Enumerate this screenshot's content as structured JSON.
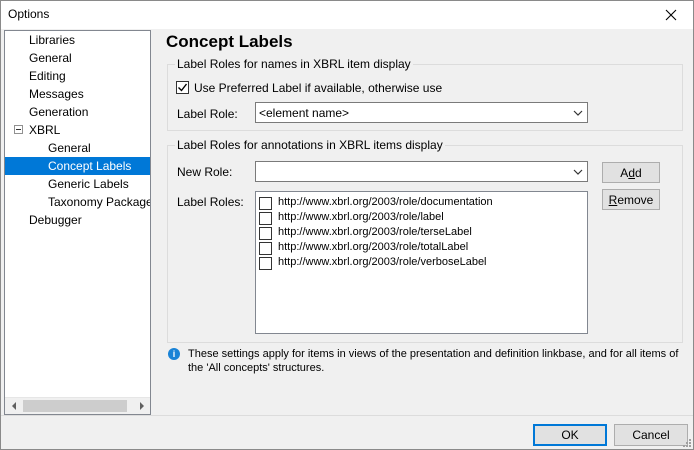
{
  "window": {
    "title": "Options"
  },
  "tree": {
    "items": [
      {
        "label": "Libraries"
      },
      {
        "label": "General"
      },
      {
        "label": "Editing"
      },
      {
        "label": "Messages"
      },
      {
        "label": "Generation"
      },
      {
        "label": "XBRL"
      },
      {
        "label": "General"
      },
      {
        "label": "Concept Labels"
      },
      {
        "label": "Generic Labels"
      },
      {
        "label": "Taxonomy Packages"
      },
      {
        "label": "Debugger"
      }
    ],
    "selected": "Concept Labels"
  },
  "panel": {
    "heading": "Concept Labels",
    "names_group": {
      "title": "Label Roles for names in XBRL item display",
      "use_preferred_label": {
        "label": "Use Preferred Label if available, otherwise use",
        "checked": true
      },
      "label_role": {
        "label": "Label Role:",
        "value": "<element name>"
      }
    },
    "annotations_group": {
      "title": "Label Roles for annotations in XBRL items display",
      "new_role": {
        "label": "New Role:",
        "value": ""
      },
      "add_button": {
        "prefix": "A",
        "underlined": "d",
        "suffix": "d"
      },
      "remove_button": {
        "prefix": "",
        "underlined": "R",
        "suffix": "emove"
      },
      "label_roles_label": "Label Roles:",
      "roles": [
        {
          "text": "http://www.xbrl.org/2003/role/documentation",
          "checked": false
        },
        {
          "text": "http://www.xbrl.org/2003/role/label",
          "checked": false
        },
        {
          "text": "http://www.xbrl.org/2003/role/terseLabel",
          "checked": false
        },
        {
          "text": "http://www.xbrl.org/2003/role/totalLabel",
          "checked": false
        },
        {
          "text": "http://www.xbrl.org/2003/role/verboseLabel",
          "checked": false
        }
      ]
    },
    "info": {
      "icon": "info-icon",
      "line1": "These settings apply for items in views of the presentation and definition linkbase, and for all items of",
      "line2": "the 'All concepts' structures."
    }
  },
  "footer": {
    "ok_label": "OK",
    "cancel_label": "Cancel"
  },
  "colors": {
    "selection": "#0078d7",
    "info": "#1a83d6",
    "window_bg": "#f0f0f0"
  }
}
